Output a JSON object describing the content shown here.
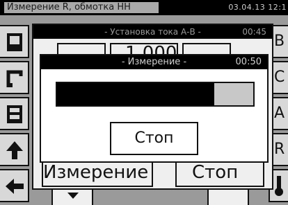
{
  "header": {
    "title": "Измерение R, обмотка НН",
    "datetime": "03.04.13 12:1"
  },
  "right_buttons": [
    "B",
    "C",
    "A",
    "R"
  ],
  "left_buttons": [
    "device-icon",
    "bracket-icon",
    "equipment-icon",
    "arrow-up-icon",
    "arrow-left-icon"
  ],
  "background_dialog": {
    "title": "- Установка тока А-В -",
    "time": "00:45",
    "value": "1.000",
    "measure_label": "Измерение",
    "stop_label": "Стоп"
  },
  "measure_dialog": {
    "title": "- Измерение -",
    "time": "00:50",
    "progress": 0.8,
    "stop_label": "Стоп"
  }
}
